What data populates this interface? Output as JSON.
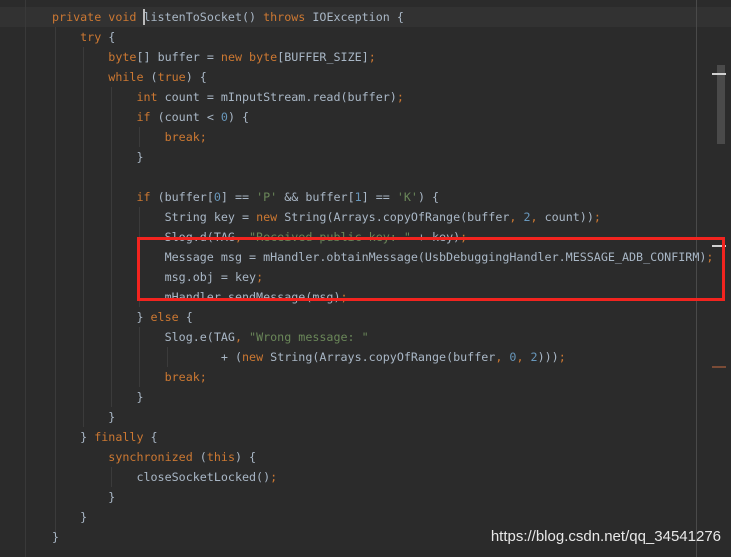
{
  "editor": {
    "lines": [
      [
        [
          "kw",
          "private void "
        ],
        [
          "txt",
          "listenToSocket() "
        ],
        [
          "kw",
          "throws "
        ],
        [
          "txt",
          "IOException {"
        ]
      ],
      [
        [
          "kw",
          "    try "
        ],
        [
          "txt",
          "{"
        ]
      ],
      [
        [
          "kw",
          "        byte"
        ],
        [
          "txt",
          "[] buffer = "
        ],
        [
          "kw",
          "new byte"
        ],
        [
          "txt",
          "[BUFFER_SIZE]"
        ],
        [
          "kw",
          ";"
        ]
      ],
      [
        [
          "kw",
          "        while "
        ],
        [
          "txt",
          "("
        ],
        [
          "kw",
          "true"
        ],
        [
          "txt",
          ") {"
        ]
      ],
      [
        [
          "kw",
          "            int "
        ],
        [
          "txt",
          "count = mInputStream.read(buffer)"
        ],
        [
          "kw",
          ";"
        ]
      ],
      [
        [
          "kw",
          "            if "
        ],
        [
          "txt",
          "(count < "
        ],
        [
          "num",
          "0"
        ],
        [
          "txt",
          ") {"
        ]
      ],
      [
        [
          "kw",
          "                break;"
        ]
      ],
      [
        [
          "txt",
          "            }"
        ]
      ],
      [
        [
          "txt",
          ""
        ]
      ],
      [
        [
          "kw",
          "            if "
        ],
        [
          "txt",
          "(buffer["
        ],
        [
          "num",
          "0"
        ],
        [
          "txt",
          "] == "
        ],
        [
          "str",
          "'P' "
        ],
        [
          "txt",
          "&& buffer["
        ],
        [
          "num",
          "1"
        ],
        [
          "txt",
          "] == "
        ],
        [
          "str",
          "'K'"
        ],
        [
          "txt",
          ") {"
        ]
      ],
      [
        [
          "txt",
          "                String key = "
        ],
        [
          "kw",
          "new "
        ],
        [
          "txt",
          "String(Arrays.copyOfRange(buffer"
        ],
        [
          "kw",
          ", "
        ],
        [
          "num",
          "2"
        ],
        [
          "kw",
          ", "
        ],
        [
          "txt",
          "count))"
        ],
        [
          "kw",
          ";"
        ]
      ],
      [
        [
          "txt",
          "                Slog.d(TAG"
        ],
        [
          "kw",
          ", "
        ],
        [
          "str",
          "\"Received public key: \" "
        ],
        [
          "txt",
          "+ key)"
        ],
        [
          "kw",
          ";"
        ]
      ],
      [
        [
          "txt",
          "                Message msg = mHandler.obtainMessage(UsbDebuggingHandler.MESSAGE_ADB_CONFIRM)"
        ],
        [
          "kw",
          ";"
        ]
      ],
      [
        [
          "txt",
          "                msg.obj = key"
        ],
        [
          "kw",
          ";"
        ]
      ],
      [
        [
          "txt",
          "                mHandler.sendMessage(msg)"
        ],
        [
          "kw",
          ";"
        ]
      ],
      [
        [
          "txt",
          "            } "
        ],
        [
          "kw",
          "else "
        ],
        [
          "txt",
          "{"
        ]
      ],
      [
        [
          "txt",
          "                Slog.e(TAG"
        ],
        [
          "kw",
          ", "
        ],
        [
          "str",
          "\"Wrong message: \""
        ]
      ],
      [
        [
          "txt",
          "                        + ("
        ],
        [
          "kw",
          "new "
        ],
        [
          "txt",
          "String(Arrays.copyOfRange(buffer"
        ],
        [
          "kw",
          ", "
        ],
        [
          "num",
          "0"
        ],
        [
          "kw",
          ", "
        ],
        [
          "num",
          "2"
        ],
        [
          "txt",
          ")))"
        ],
        [
          "kw",
          ";"
        ]
      ],
      [
        [
          "kw",
          "                break;"
        ]
      ],
      [
        [
          "txt",
          "            }"
        ]
      ],
      [
        [
          "txt",
          "        }"
        ]
      ],
      [
        [
          "txt",
          "    } "
        ],
        [
          "kw",
          "finally "
        ],
        [
          "txt",
          "{"
        ]
      ],
      [
        [
          "kw",
          "        synchronized "
        ],
        [
          "txt",
          "("
        ],
        [
          "kw",
          "this"
        ],
        [
          "txt",
          ") {"
        ]
      ],
      [
        [
          "txt",
          "            closeSocketLocked()"
        ],
        [
          "kw",
          ";"
        ]
      ],
      [
        [
          "txt",
          "        }"
        ]
      ],
      [
        [
          "txt",
          "    }"
        ]
      ],
      [
        [
          "txt",
          "}"
        ]
      ]
    ]
  },
  "colors": {
    "background": "#2b2b2b",
    "keyword": "#cc7832",
    "text": "#a9b7c6",
    "number": "#6897bb",
    "string": "#6a8759",
    "highlight_box": "#f2241f"
  },
  "watermark": "https://blog.csdn.net/qq_34541276"
}
